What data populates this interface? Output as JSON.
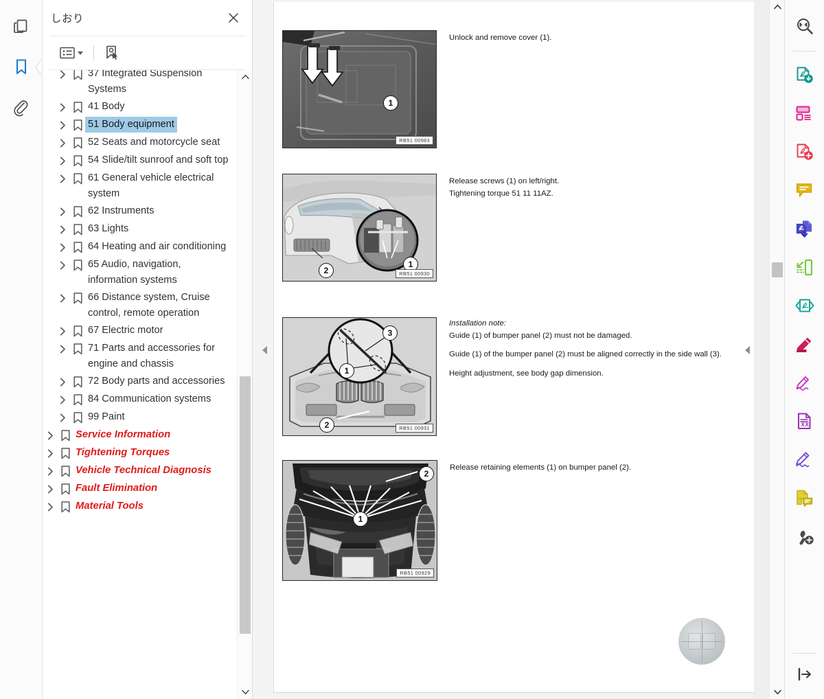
{
  "left_rail": {
    "items": [
      {
        "name": "page-thumbnails-icon",
        "title": "Page Thumbnails"
      },
      {
        "name": "bookmarks-icon",
        "title": "Bookmarks",
        "active": true
      },
      {
        "name": "attachments-icon",
        "title": "Attachments"
      }
    ]
  },
  "bookmark_panel": {
    "title": "しおり",
    "close_label": "×",
    "toolbar": {
      "options_label": "Options",
      "expand_caret": "▾",
      "find_bookmark_label": "Find current bookmark"
    },
    "scroll": {
      "up_arrow": "⌃",
      "down_arrow": "⌄"
    },
    "items": [
      {
        "label": "37 Integrated Suspension Systems",
        "level": 1,
        "style": "normal",
        "clipped": true
      },
      {
        "label": "41 Body",
        "level": 1,
        "style": "normal"
      },
      {
        "label": "51 Body equipment",
        "level": 1,
        "style": "selected"
      },
      {
        "label": "52 Seats and motorcycle seat",
        "level": 1,
        "style": "normal"
      },
      {
        "label": "54 Slide/tilt sunroof and soft top",
        "level": 1,
        "style": "normal"
      },
      {
        "label": "61 General vehicle electrical system",
        "level": 1,
        "style": "normal"
      },
      {
        "label": "62 Instruments",
        "level": 1,
        "style": "normal"
      },
      {
        "label": "63 Lights",
        "level": 1,
        "style": "normal"
      },
      {
        "label": "64 Heating and air conditioning",
        "level": 1,
        "style": "normal"
      },
      {
        "label": "65 Audio, navigation, information systems",
        "level": 1,
        "style": "normal"
      },
      {
        "label": "66 Distance system, Cruise control, remote operation",
        "level": 1,
        "style": "normal"
      },
      {
        "label": "67 Electric motor",
        "level": 1,
        "style": "normal"
      },
      {
        "label": "71 Parts and accessories for engine and chassis",
        "level": 1,
        "style": "normal"
      },
      {
        "label": "72 Body parts and accessories",
        "level": 1,
        "style": "normal"
      },
      {
        "label": "84 Communication systems",
        "level": 1,
        "style": "normal"
      },
      {
        "label": "99 Paint",
        "level": 1,
        "style": "normal"
      },
      {
        "label": "Service Information",
        "level": 0,
        "style": "red"
      },
      {
        "label": "Tightening Torques",
        "level": 0,
        "style": "red"
      },
      {
        "label": "Vehicle Technical Diagnosis",
        "level": 0,
        "style": "red"
      },
      {
        "label": "Fault Elimination",
        "level": 0,
        "style": "red"
      },
      {
        "label": "Material Tools",
        "level": 0,
        "style": "red",
        "clipped": true
      }
    ]
  },
  "document": {
    "collapse_left_glyph": "◀",
    "collapse_right_glyph": "◀",
    "scroll": {
      "up_arrow": "⌃",
      "down_arrow": "⌄"
    },
    "figures": [
      {
        "code": "RB51 00983",
        "callouts": [
          "1"
        ],
        "text_lines": [
          {
            "text": "Unlock and remove cover (1).",
            "italic": false,
            "gap": false
          }
        ]
      },
      {
        "code": "RB51 00930",
        "callouts": [
          "1",
          "2"
        ],
        "text_lines": [
          {
            "text": "Release screws (1) on left/right.",
            "italic": false,
            "gap": false
          },
          {
            "text": "Tightening torque 51 11 11AZ.",
            "italic": false,
            "gap": false
          }
        ]
      },
      {
        "code": "RB51 00931",
        "callouts": [
          "1",
          "2",
          "3"
        ],
        "text_lines": [
          {
            "text": "Installation note:",
            "italic": true,
            "gap": false
          },
          {
            "text": "Guide (1) of bumper panel (2) must not be damaged.",
            "italic": false,
            "gap": false
          },
          {
            "text": "Guide (1) of the bumper panel (2) must be aligned correctly in the side wall (3).",
            "italic": false,
            "gap": true
          },
          {
            "text": "Height adjustment, see  body gap dimension.",
            "italic": false,
            "gap": true
          }
        ]
      },
      {
        "code": "RB51 00929",
        "callouts": [
          "1",
          "2"
        ],
        "text_lines": [
          {
            "text": "Release retaining elements (1) on bumper panel (2).",
            "italic": false,
            "gap": false
          }
        ]
      }
    ]
  },
  "tool_rail": {
    "items": [
      {
        "name": "search-icon",
        "title": "Search",
        "color": "#444444"
      },
      {
        "name": "export-pdf-icon",
        "title": "Export PDF",
        "color": "#11998e"
      },
      {
        "name": "organize-pages-icon",
        "title": "Organize Pages",
        "color": "#e0218a"
      },
      {
        "name": "create-pdf-icon",
        "title": "Create PDF",
        "color": "#e83a4e"
      },
      {
        "name": "comment-icon",
        "title": "Comment",
        "color": "#e3b515"
      },
      {
        "name": "combine-files-icon",
        "title": "Combine Files",
        "color": "#5b5bd6"
      },
      {
        "name": "compress-pdf-icon",
        "title": "Compress PDF",
        "color": "#7ac943"
      },
      {
        "name": "protect-pdf-icon",
        "title": "Protect",
        "color": "#18a5a0"
      },
      {
        "name": "edit-pdf-icon",
        "title": "Edit PDF",
        "color": "#d81b60"
      },
      {
        "name": "fill-sign-icon",
        "title": "Fill & Sign",
        "color": "#c640c6"
      },
      {
        "name": "export-excel-icon",
        "title": "Export to Excel",
        "color": "#9b30b8"
      },
      {
        "name": "request-signature-icon",
        "title": "Request Signatures",
        "color": "#7b52d3"
      },
      {
        "name": "stamp-comment-icon",
        "title": "Stamp",
        "color": "#d4c023"
      },
      {
        "name": "more-tools-icon",
        "title": "More Tools",
        "color": "#4a4a4a"
      }
    ],
    "bottom": {
      "name": "expand-panel-icon",
      "title": "Expand panel"
    }
  }
}
